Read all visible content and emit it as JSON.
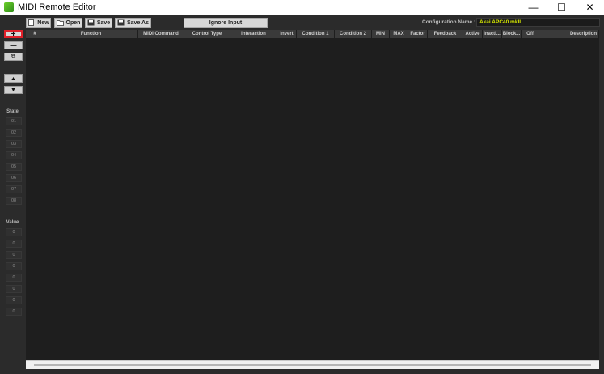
{
  "window": {
    "title": "MIDI Remote Editor",
    "min": "—",
    "max": "☐",
    "close": "✕"
  },
  "toolbar": {
    "new": "New",
    "open": "Open",
    "save": "Save",
    "save_as": "Save As",
    "ignore_input": "Ignore Input",
    "config_label": "Configuration Name :",
    "config_value": "Akai APC40 mkII"
  },
  "left": {
    "add": "+",
    "remove": "—",
    "copy": "⧉",
    "up": "▲",
    "down": "▼",
    "state_label": "State",
    "states": [
      "01",
      "02",
      "03",
      "04",
      "05",
      "06",
      "07",
      "08"
    ],
    "value_label": "Value",
    "values": [
      "0",
      "0",
      "0",
      "0",
      "0",
      "0",
      "0",
      "0"
    ]
  },
  "columns": [
    "#",
    "Function",
    "MIDI Command",
    "Control Type",
    "Interaction",
    "Invert",
    "Condition 1",
    "Condition 2",
    "MIN",
    "MAX",
    "Factor",
    "Feedback",
    "Active",
    "Inacti...",
    "Block...",
    "Off",
    "Description"
  ],
  "colors": {
    "accent": "#d4e600",
    "selection": "#e0202a"
  }
}
